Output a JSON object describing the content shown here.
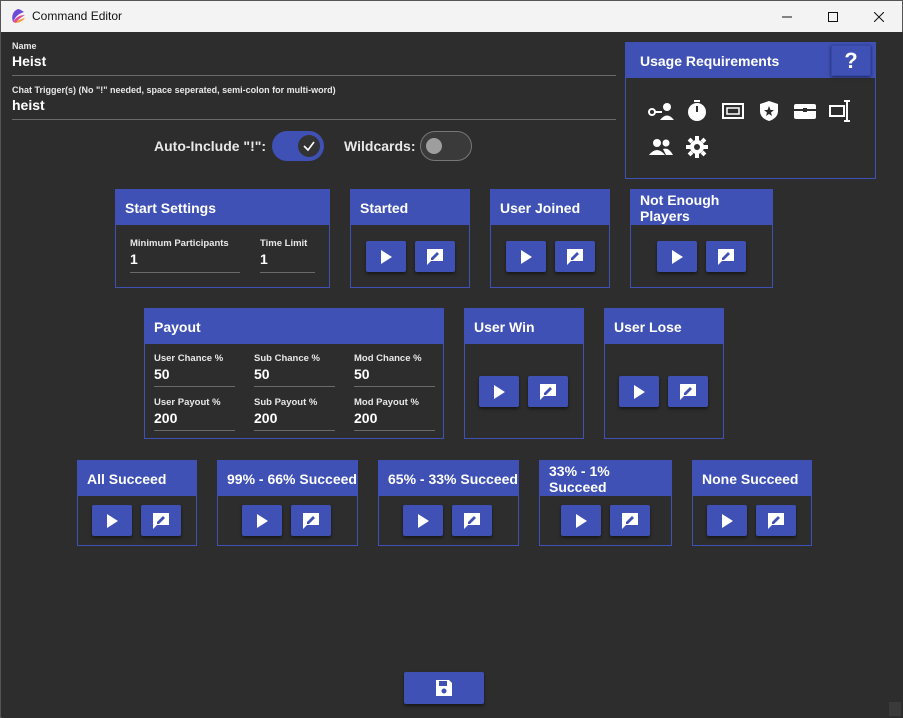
{
  "window": {
    "title": "Command Editor"
  },
  "name_field": {
    "label": "Name",
    "value": "Heist"
  },
  "trigger_field": {
    "label": "Chat Trigger(s) (No \"!\" needed, space seperated, semi-colon for multi-word)",
    "value": "heist"
  },
  "toggles": {
    "auto_include": {
      "label": "Auto-Include \"!\":",
      "on": true
    },
    "wildcards": {
      "label": "Wildcards:",
      "on": false
    }
  },
  "usage": {
    "title": "Usage Requirements",
    "help": "?",
    "icons": [
      "key-user-icon",
      "timer-icon",
      "currency-icon",
      "badge-star-icon",
      "chest-icon",
      "text-input-icon",
      "users-icon",
      "settings-icon"
    ]
  },
  "start_settings": {
    "title": "Start Settings",
    "min_participants": {
      "label": "Minimum Participants",
      "value": "1"
    },
    "time_limit": {
      "label": "Time Limit",
      "value": "1"
    }
  },
  "panels_row1": [
    {
      "title": "Started"
    },
    {
      "title": "User Joined"
    },
    {
      "title": "Not Enough Players"
    }
  ],
  "payout": {
    "title": "Payout",
    "user_chance": {
      "label": "User Chance %",
      "value": "50"
    },
    "sub_chance": {
      "label": "Sub Chance %",
      "value": "50"
    },
    "mod_chance": {
      "label": "Mod Chance %",
      "value": "50"
    },
    "user_payout": {
      "label": "User Payout %",
      "value": "200"
    },
    "sub_payout": {
      "label": "Sub Payout %",
      "value": "200"
    },
    "mod_payout": {
      "label": "Mod Payout %",
      "value": "200"
    }
  },
  "panels_row2": [
    {
      "title": "User Win"
    },
    {
      "title": "User Lose"
    }
  ],
  "panels_row3": [
    {
      "title": "All Succeed"
    },
    {
      "title": "99% - 66% Succeed"
    },
    {
      "title": "65% - 33% Succeed"
    },
    {
      "title": "33% - 1% Succeed"
    },
    {
      "title": "None Succeed"
    }
  ],
  "colors": {
    "accent": "#3f51b5",
    "background": "#2d2d2d"
  }
}
